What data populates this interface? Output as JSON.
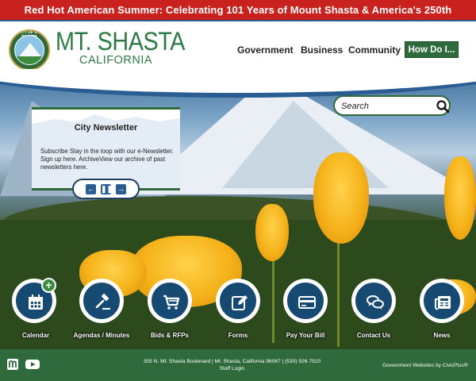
{
  "alert": {
    "text": "Red Hot American Summer: Celebrating 101 Years of Mount Shasta & America's 250th"
  },
  "header": {
    "title": "MT. SHASTA",
    "subtitle": "CALIFORNIA",
    "seal_text": "CITY OF MT. SHASTA"
  },
  "nav": {
    "items": [
      {
        "label": "Government"
      },
      {
        "label": "Business"
      },
      {
        "label": "Community"
      }
    ],
    "how_do_i": "How Do I..."
  },
  "search": {
    "placeholder": "Search"
  },
  "newsletter": {
    "title": "City Newsletter",
    "body": "Subscribe Stay in the loop with our e-Newsletter. Sign up here. ArchiveView our archive of past newsletters here."
  },
  "quick_links": [
    {
      "label": "Calendar",
      "icon": "calendar-icon"
    },
    {
      "label": "Agendas / Minutes",
      "icon": "gavel-icon"
    },
    {
      "label": "Bids & RFPs",
      "icon": "cart-icon"
    },
    {
      "label": "Forms",
      "icon": "edit-icon"
    },
    {
      "label": "Pay Your Bill",
      "icon": "credit-card-icon"
    },
    {
      "label": "Contact Us",
      "icon": "chat-icon"
    },
    {
      "label": "News",
      "icon": "newspaper-icon"
    }
  ],
  "footer": {
    "address": "305 N. Mt. Shasta Boulevard | Mt. Shasta, California 96067 | (530) 926-7510",
    "staff_login": "Staff Login",
    "credit": "Government Websites by CivicPlus®"
  },
  "colors": {
    "alert": "#c8211e",
    "brand_green": "#2e6a3b",
    "icon_blue": "#174a72",
    "accent_blue": "#2a5d92"
  }
}
